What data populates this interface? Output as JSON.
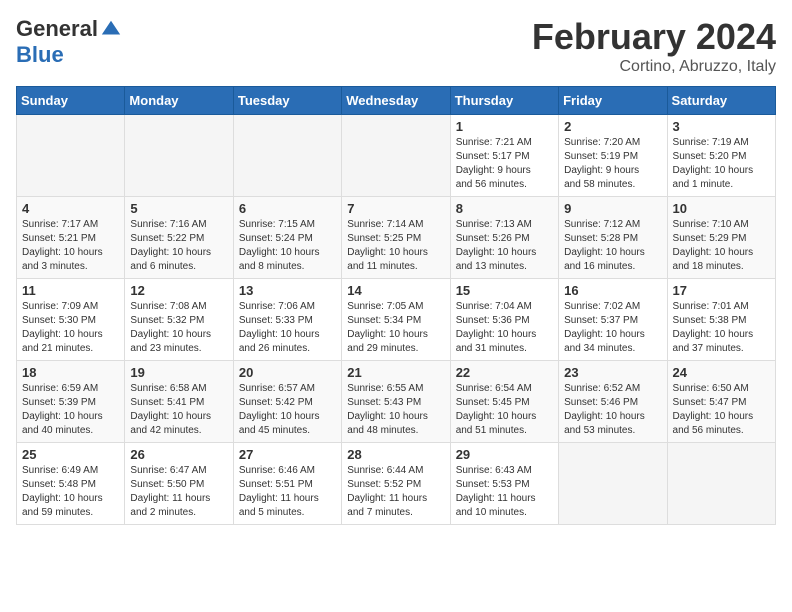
{
  "logo": {
    "general": "General",
    "blue": "Blue"
  },
  "header": {
    "month": "February 2024",
    "location": "Cortino, Abruzzo, Italy"
  },
  "weekdays": [
    "Sunday",
    "Monday",
    "Tuesday",
    "Wednesday",
    "Thursday",
    "Friday",
    "Saturday"
  ],
  "weeks": [
    [
      {
        "day": "",
        "info": ""
      },
      {
        "day": "",
        "info": ""
      },
      {
        "day": "",
        "info": ""
      },
      {
        "day": "",
        "info": ""
      },
      {
        "day": "1",
        "info": "Sunrise: 7:21 AM\nSunset: 5:17 PM\nDaylight: 9 hours\nand 56 minutes."
      },
      {
        "day": "2",
        "info": "Sunrise: 7:20 AM\nSunset: 5:19 PM\nDaylight: 9 hours\nand 58 minutes."
      },
      {
        "day": "3",
        "info": "Sunrise: 7:19 AM\nSunset: 5:20 PM\nDaylight: 10 hours\nand 1 minute."
      }
    ],
    [
      {
        "day": "4",
        "info": "Sunrise: 7:17 AM\nSunset: 5:21 PM\nDaylight: 10 hours\nand 3 minutes."
      },
      {
        "day": "5",
        "info": "Sunrise: 7:16 AM\nSunset: 5:22 PM\nDaylight: 10 hours\nand 6 minutes."
      },
      {
        "day": "6",
        "info": "Sunrise: 7:15 AM\nSunset: 5:24 PM\nDaylight: 10 hours\nand 8 minutes."
      },
      {
        "day": "7",
        "info": "Sunrise: 7:14 AM\nSunset: 5:25 PM\nDaylight: 10 hours\nand 11 minutes."
      },
      {
        "day": "8",
        "info": "Sunrise: 7:13 AM\nSunset: 5:26 PM\nDaylight: 10 hours\nand 13 minutes."
      },
      {
        "day": "9",
        "info": "Sunrise: 7:12 AM\nSunset: 5:28 PM\nDaylight: 10 hours\nand 16 minutes."
      },
      {
        "day": "10",
        "info": "Sunrise: 7:10 AM\nSunset: 5:29 PM\nDaylight: 10 hours\nand 18 minutes."
      }
    ],
    [
      {
        "day": "11",
        "info": "Sunrise: 7:09 AM\nSunset: 5:30 PM\nDaylight: 10 hours\nand 21 minutes."
      },
      {
        "day": "12",
        "info": "Sunrise: 7:08 AM\nSunset: 5:32 PM\nDaylight: 10 hours\nand 23 minutes."
      },
      {
        "day": "13",
        "info": "Sunrise: 7:06 AM\nSunset: 5:33 PM\nDaylight: 10 hours\nand 26 minutes."
      },
      {
        "day": "14",
        "info": "Sunrise: 7:05 AM\nSunset: 5:34 PM\nDaylight: 10 hours\nand 29 minutes."
      },
      {
        "day": "15",
        "info": "Sunrise: 7:04 AM\nSunset: 5:36 PM\nDaylight: 10 hours\nand 31 minutes."
      },
      {
        "day": "16",
        "info": "Sunrise: 7:02 AM\nSunset: 5:37 PM\nDaylight: 10 hours\nand 34 minutes."
      },
      {
        "day": "17",
        "info": "Sunrise: 7:01 AM\nSunset: 5:38 PM\nDaylight: 10 hours\nand 37 minutes."
      }
    ],
    [
      {
        "day": "18",
        "info": "Sunrise: 6:59 AM\nSunset: 5:39 PM\nDaylight: 10 hours\nand 40 minutes."
      },
      {
        "day": "19",
        "info": "Sunrise: 6:58 AM\nSunset: 5:41 PM\nDaylight: 10 hours\nand 42 minutes."
      },
      {
        "day": "20",
        "info": "Sunrise: 6:57 AM\nSunset: 5:42 PM\nDaylight: 10 hours\nand 45 minutes."
      },
      {
        "day": "21",
        "info": "Sunrise: 6:55 AM\nSunset: 5:43 PM\nDaylight: 10 hours\nand 48 minutes."
      },
      {
        "day": "22",
        "info": "Sunrise: 6:54 AM\nSunset: 5:45 PM\nDaylight: 10 hours\nand 51 minutes."
      },
      {
        "day": "23",
        "info": "Sunrise: 6:52 AM\nSunset: 5:46 PM\nDaylight: 10 hours\nand 53 minutes."
      },
      {
        "day": "24",
        "info": "Sunrise: 6:50 AM\nSunset: 5:47 PM\nDaylight: 10 hours\nand 56 minutes."
      }
    ],
    [
      {
        "day": "25",
        "info": "Sunrise: 6:49 AM\nSunset: 5:48 PM\nDaylight: 10 hours\nand 59 minutes."
      },
      {
        "day": "26",
        "info": "Sunrise: 6:47 AM\nSunset: 5:50 PM\nDaylight: 11 hours\nand 2 minutes."
      },
      {
        "day": "27",
        "info": "Sunrise: 6:46 AM\nSunset: 5:51 PM\nDaylight: 11 hours\nand 5 minutes."
      },
      {
        "day": "28",
        "info": "Sunrise: 6:44 AM\nSunset: 5:52 PM\nDaylight: 11 hours\nand 7 minutes."
      },
      {
        "day": "29",
        "info": "Sunrise: 6:43 AM\nSunset: 5:53 PM\nDaylight: 11 hours\nand 10 minutes."
      },
      {
        "day": "",
        "info": ""
      },
      {
        "day": "",
        "info": ""
      }
    ]
  ]
}
